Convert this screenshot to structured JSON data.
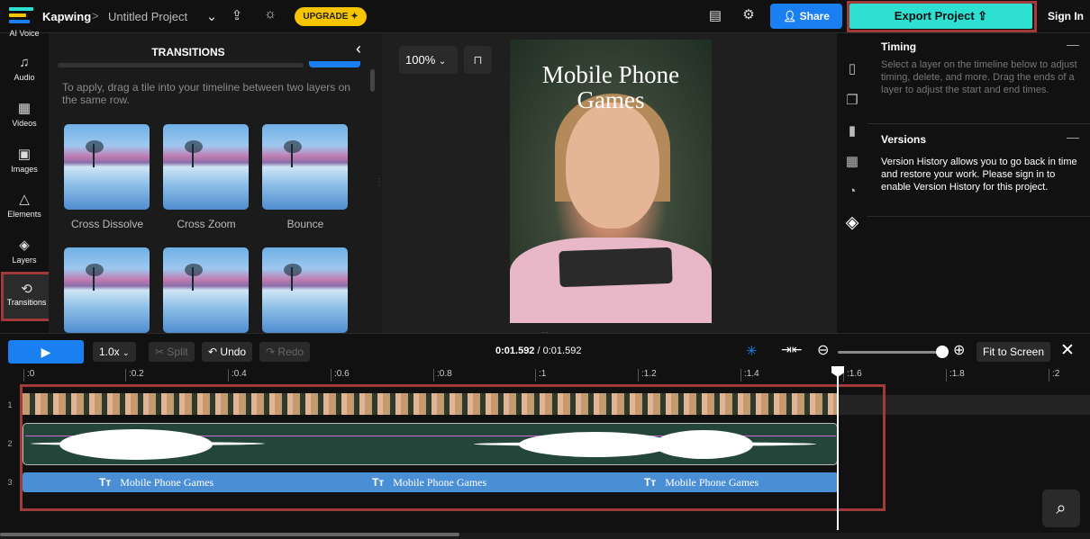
{
  "header": {
    "brand": "Kapwing",
    "separator": ">",
    "project": "Untitled Project",
    "upgrade": "UPGRADE",
    "share": "Share",
    "export": "Export Project",
    "signin": "Sign In"
  },
  "sidebar": {
    "items": [
      {
        "label": "AI Voice"
      },
      {
        "label": "Audio"
      },
      {
        "label": "Videos"
      },
      {
        "label": "Images"
      },
      {
        "label": "Elements"
      },
      {
        "label": "Layers"
      },
      {
        "label": "Transitions"
      }
    ]
  },
  "panel": {
    "title": "TRANSITIONS",
    "hint": "To apply, drag a tile into your timeline between two layers on the same row.",
    "tiles": [
      "Cross Dissolve",
      "Cross Zoom",
      "Bounce"
    ]
  },
  "canvas": {
    "zoom": "100%",
    "video_title": "Mobile Phone Games"
  },
  "rightpanel": {
    "timing_title": "Timing",
    "timing_text": "Select a layer on the timeline below to adjust timing, delete, and more. Drag the ends of a layer to adjust the start and end times.",
    "versions_title": "Versions",
    "versions_text": "Version History allows you to go back in time and restore your work. Please sign in to enable Version History for this project."
  },
  "timeline": {
    "speed": "1.0x",
    "split": "Split",
    "undo": "Undo",
    "redo": "Redo",
    "current": "0:01.592",
    "total": "/ 0:01.592",
    "fit": "Fit to Screen",
    "ticks": [
      ":0",
      ":0.2",
      ":0.4",
      ":0.6",
      ":0.8",
      ":1",
      ":1.2",
      ":1.4",
      ":1.6",
      ":1.8",
      ":2"
    ],
    "rows": [
      "1",
      "2",
      "3"
    ],
    "text_layer": "Mobile Phone Games",
    "text_icon": "Tт"
  },
  "colors": {
    "accent": "#1a7ff0",
    "export": "#2de0d2",
    "highlight": "#a13a3a",
    "upgrade": "#f6c500"
  }
}
